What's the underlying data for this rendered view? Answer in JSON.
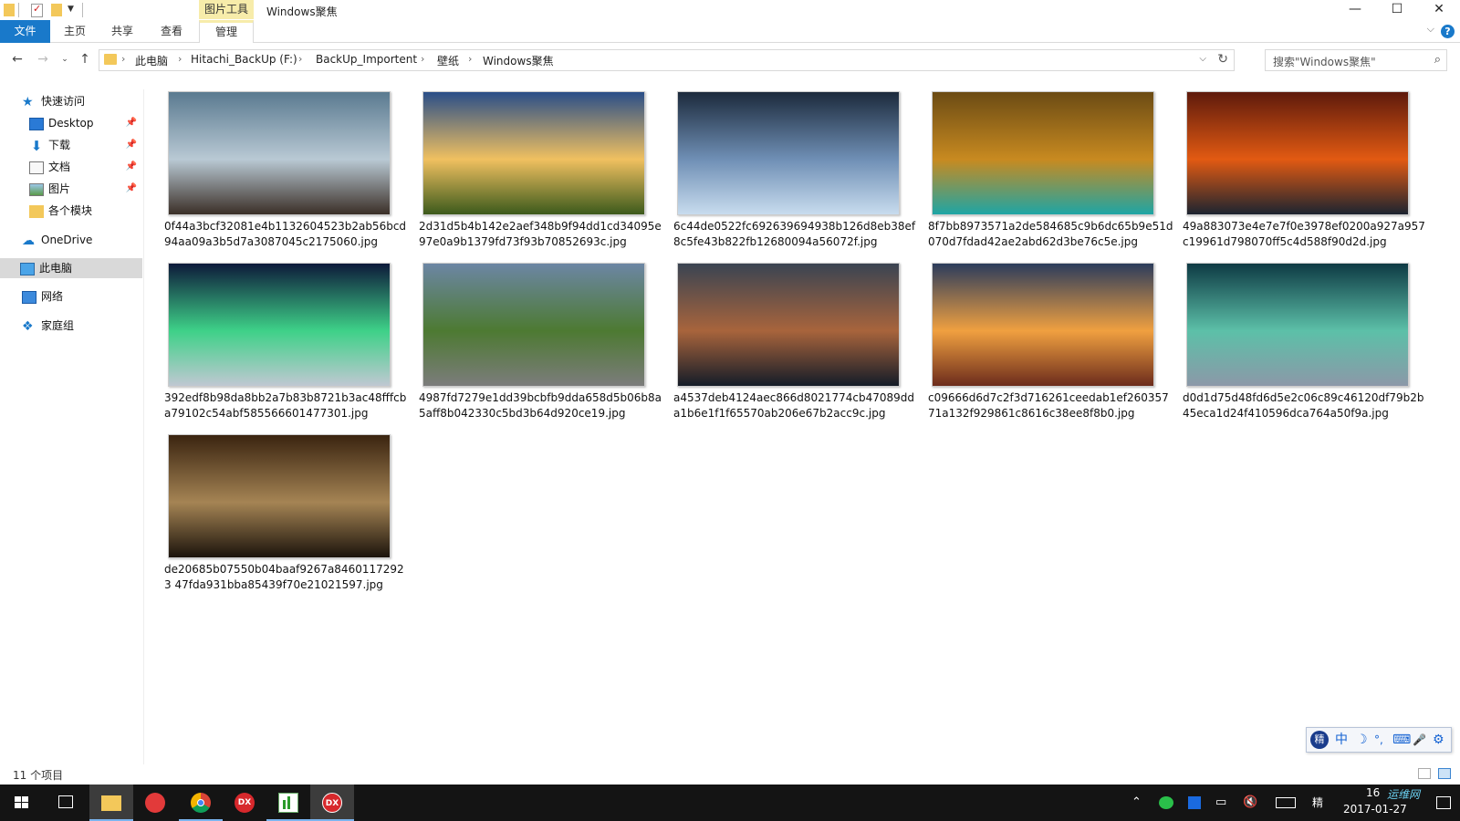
{
  "window": {
    "title": "Windows聚焦",
    "tools_header": "图片工具",
    "controls": {
      "minimize": "—",
      "maximize": "☐",
      "close": "✕"
    }
  },
  "ribbon": {
    "tabs": [
      "文件",
      "主页",
      "共享",
      "查看",
      "管理"
    ],
    "help": "?"
  },
  "address": {
    "crumbs": [
      "此电脑",
      "Hitachi_BackUp (F:)",
      "BackUp_Importent",
      "壁纸",
      "Windows聚焦"
    ],
    "search_placeholder": "搜索\"Windows聚焦\""
  },
  "nav_pane": {
    "quick_access": "快速访问",
    "quick_items": [
      "Desktop",
      "下载",
      "文档",
      "图片",
      "各个模块"
    ],
    "onedrive": "OneDrive",
    "this_pc": "此电脑",
    "network": "网络",
    "homegroup": "家庭组"
  },
  "files": [
    {
      "name": "0f44a3bcf32081e4b1132604523b2ab56bcd94aa09a3b5d7a3087045c2175060.jpg",
      "grad": [
        "#5a7a90",
        "#b9c9d4",
        "#3b2f27"
      ]
    },
    {
      "name": "2d31d5b4b142e2aef348b9f94dd1cd34095e97e0a9b1379fd73f93b70852693c.jpg",
      "grad": [
        "#2a4e88",
        "#f0c060",
        "#3c5a1c"
      ]
    },
    {
      "name": "6c44de0522fc692639694938b126d8eb38ef8c5fe43b822fb12680094a56072f.jpg",
      "grad": [
        "#1c2a3c",
        "#6f8fb5",
        "#c8dcee"
      ]
    },
    {
      "name": "8f7bb8973571a2de584685c9b6dc65b9e51d070d7fdad42ae2abd62d3be76c5e.jpg",
      "grad": [
        "#6b4b14",
        "#c88a20",
        "#1ea5a5"
      ]
    },
    {
      "name": "49a883073e4e7e7f0e3978ef0200a927a957c19961d798070ff5c4d588f90d2d.jpg",
      "grad": [
        "#5e1a0c",
        "#e25a12",
        "#1c2430"
      ]
    },
    {
      "name": "392edf8b98da8bb2a7b83b8721b3ac48fffcba79102c54abf585566601477301.jpg",
      "grad": [
        "#0d1a3a",
        "#3ed188",
        "#c0c8d2"
      ]
    },
    {
      "name": "4987fd7279e1dd39bcbfb9dda658d5b06b8a5aff8b042330c5bd3b64d920ce19.jpg",
      "grad": [
        "#6c86a4",
        "#4d7a32",
        "#7c7c7c"
      ]
    },
    {
      "name": "a4537deb4124aec866d8021774cb47089dda1b6e1f1f65570ab206e67b2acc9c.jpg",
      "grad": [
        "#3a4452",
        "#a8643c",
        "#141c28"
      ]
    },
    {
      "name": "c09666d6d7c2f3d716261ceedab1ef26035771a132f929861c8616c38ee8f8b0.jpg",
      "grad": [
        "#2c3c5c",
        "#f0a040",
        "#6c2c1c"
      ]
    },
    {
      "name": "d0d1d75d48fd6d5e2c06c89c46120df79b2b45eca1d24f410596dca764a50f9a.jpg",
      "grad": [
        "#0e3a44",
        "#5cc0a8",
        "#8c98a8"
      ]
    },
    {
      "name": "de20685b07550b04baaf9267a84601172923 47fda931bba85439f70e21021597.jpg",
      "grad": [
        "#3a2410",
        "#a58454",
        "#1c140c"
      ]
    }
  ],
  "status": {
    "count": "11 个项目"
  },
  "ime": {
    "items": [
      "中",
      "☽",
      "°,",
      "⌨",
      "🎤",
      "⚙"
    ]
  },
  "taskbar": {
    "time": "16",
    "date": "2017-01-27",
    "watermark": "运维网"
  },
  "colors": {
    "accent": "#1979ca",
    "tools_tab": "#f7ecaa",
    "selection": "#d9d9d9",
    "taskbar": "#141414"
  }
}
